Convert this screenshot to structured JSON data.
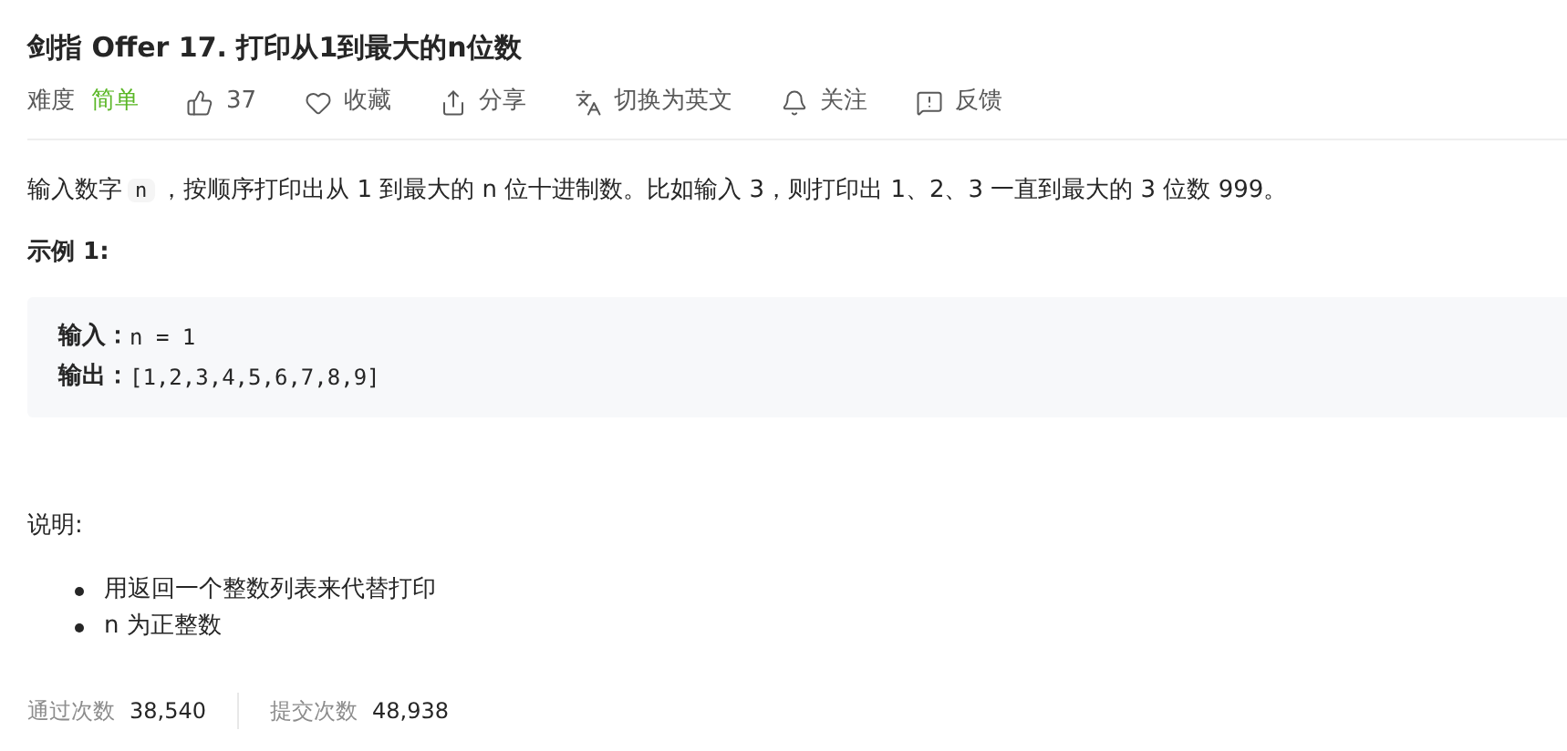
{
  "title": "剑指 Offer 17. 打印从1到最大的n位数",
  "meta": {
    "difficulty_label": "难度",
    "difficulty": "简单",
    "actions": [
      {
        "kind": "like",
        "label": "37"
      },
      {
        "kind": "favorite",
        "label": "收藏"
      },
      {
        "kind": "share",
        "label": "分享"
      },
      {
        "kind": "translate",
        "label": "切换为英文"
      },
      {
        "kind": "follow",
        "label": "关注"
      },
      {
        "kind": "feedback",
        "label": "反馈"
      }
    ]
  },
  "description": {
    "before": "输入数字",
    "code": "n",
    "after": "，按顺序打印出从 1 到最大的 n 位十进制数。比如输入 3，则打印出 1、2、3 一直到最大的 3 位数 999。"
  },
  "example": {
    "heading": "示例 1:",
    "lines": [
      {
        "label": "输入：",
        "value": "n = 1"
      },
      {
        "label": "输出：",
        "value": "[1,2,3,4,5,6,7,8,9]"
      }
    ]
  },
  "notes": {
    "heading": "说明:",
    "items": [
      "用返回一个整数列表来代替打印",
      "n 为正整数"
    ]
  },
  "stats": [
    {
      "label": "通过次数",
      "value": "38,540"
    },
    {
      "label": "提交次数",
      "value": "48,938"
    }
  ]
}
